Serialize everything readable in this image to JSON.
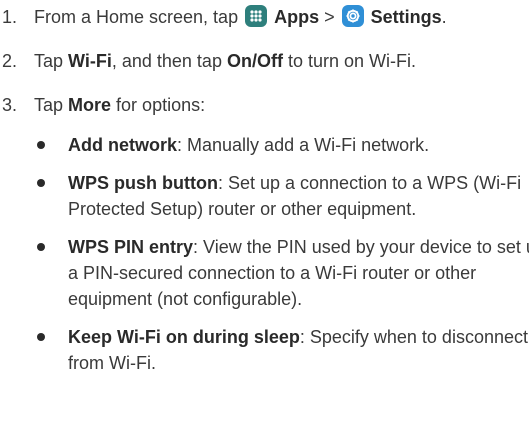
{
  "steps": [
    {
      "number": "1.",
      "text_before": "From a Home screen, tap ",
      "apps_label": "Apps",
      "separator": " > ",
      "settings_label": "Settings",
      "text_after": "."
    },
    {
      "number": "2.",
      "text_before": "Tap ",
      "wifi_label": "Wi-Fi",
      "text_middle": ", and then tap ",
      "onoff_label": "On/Off",
      "text_after": " to turn on Wi-Fi."
    },
    {
      "number": "3.",
      "text_before": "Tap ",
      "more_label": "More",
      "text_after": " for options:"
    }
  ],
  "options": [
    {
      "term": "Add network",
      "description": ": Manually add a Wi-Fi network."
    },
    {
      "term": "WPS push button",
      "description": ": Set up a connection to a WPS (Wi-Fi Protected Setup) router or other equipment."
    },
    {
      "term": "WPS PIN entry",
      "description": ": View the PIN used by your device to set up a PIN-secured connection to a Wi-Fi router or other equipment (not configurable)."
    },
    {
      "term": "Keep Wi-Fi on during sleep",
      "description": ": Specify when to disconnect from Wi-Fi."
    }
  ],
  "icons": {
    "apps": "apps-grid-icon",
    "settings": "settings-gear-icon",
    "apps_color": "#2e7f7c",
    "settings_color": "#2f8fd6"
  }
}
